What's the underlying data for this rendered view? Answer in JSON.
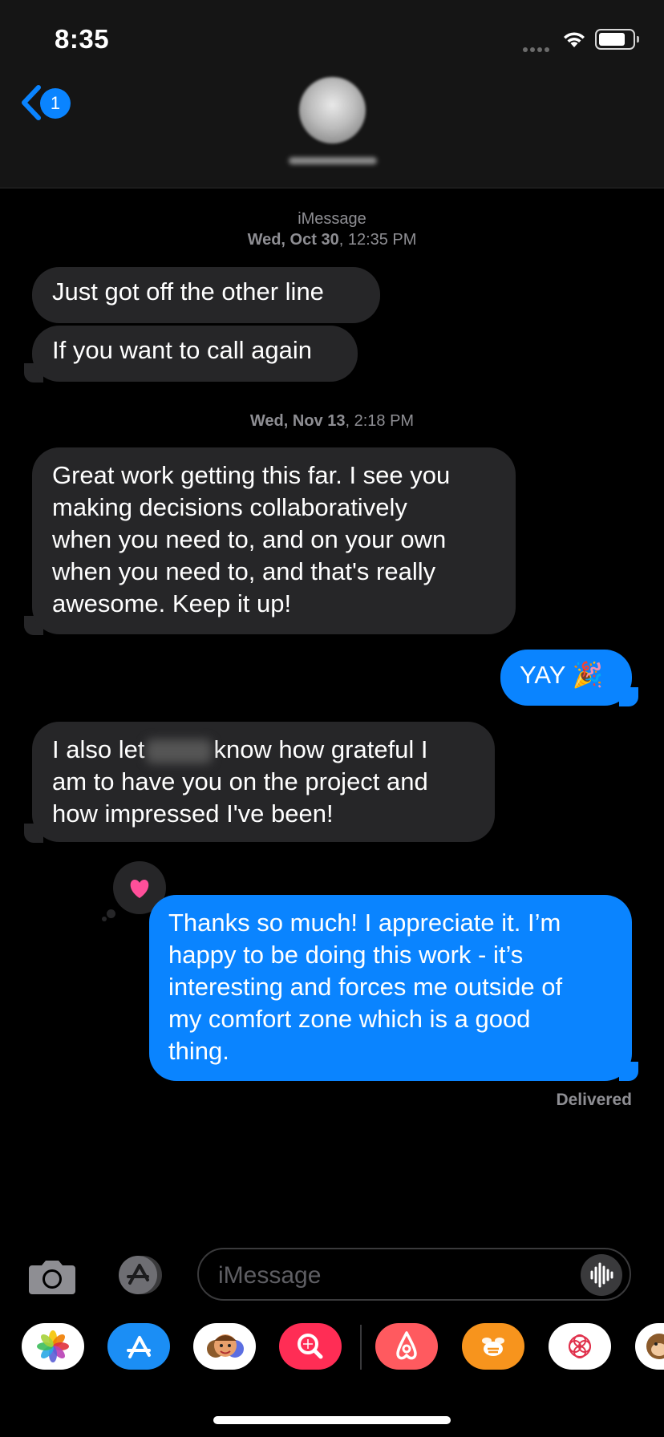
{
  "status_bar": {
    "time": "8:35"
  },
  "nav": {
    "back_badge": "1"
  },
  "thread": [
    {
      "service": "iMessage",
      "day": "Wed, Oct 30",
      "time": ", 12:35 PM"
    },
    {
      "day": "Wed, Nov 13",
      "time": ", 2:18 PM"
    }
  ],
  "messages": [
    {
      "text": "Just got off the other line"
    },
    {
      "text": "If you want to call again"
    },
    {
      "lines": [
        "Great work getting this far. I see you",
        "making decisions collaboratively",
        "when you need to, and on your own",
        "when you need to, and that's really",
        "awesome. Keep it up!"
      ]
    },
    {
      "text": "YAY",
      "emoji": "🎉"
    },
    {
      "line1_pre": "I also let",
      "line1_post": "know how grateful I",
      "line2": "am to have you on the project and",
      "line3": "how impressed I've been!"
    },
    {
      "lines": [
        "Thanks so much! I appreciate it. I’m",
        "happy to be doing this work - it’s",
        "interesting and forces me outside of",
        "my comfort zone which is a good",
        "thing."
      ]
    }
  ],
  "status": {
    "delivered": "Delivered"
  },
  "compose": {
    "placeholder": "iMessage"
  },
  "colors": {
    "accent": "#0a84ff",
    "incoming_bubble": "#262628",
    "background": "#000000"
  }
}
